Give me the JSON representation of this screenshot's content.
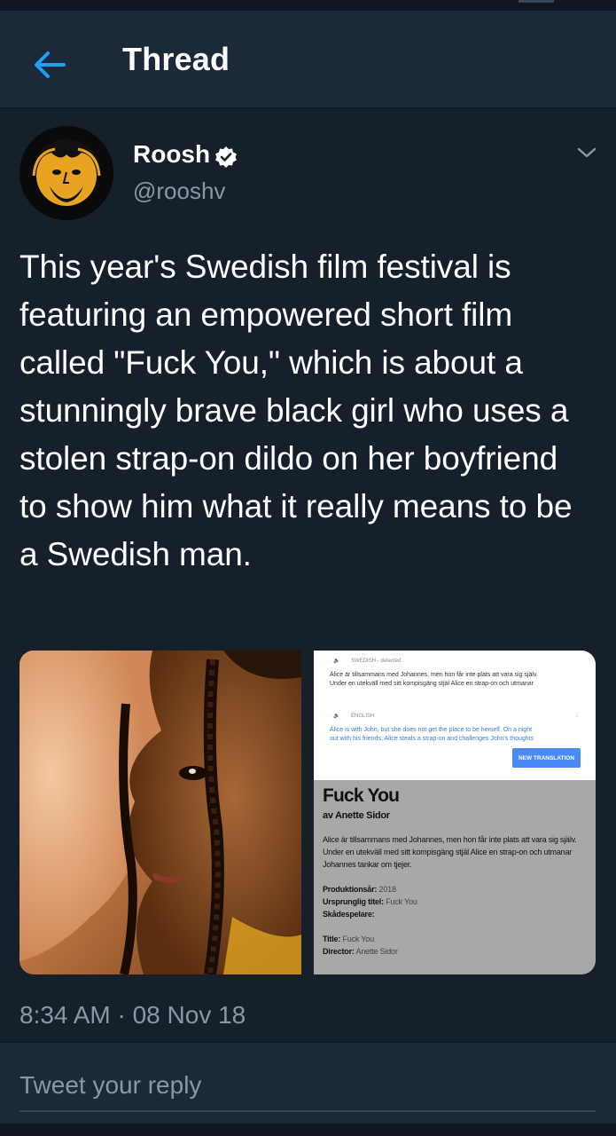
{
  "header": {
    "title": "Thread",
    "back_icon": "arrow-left-icon",
    "accent": "#1da1f2"
  },
  "tweet": {
    "author_name": "Roosh",
    "handle": "@rooshv",
    "verified": true,
    "text": "This year's Swedish film festival is featuring an empowered short film called \"Fuck You,\" which is about a stunningly brave black girl who uses a stolen strap-on dildo on her boyfriend to show him what it really means to be a Swedish man.",
    "timestamp": "8:34 AM · 08 Nov 18"
  },
  "media": {
    "translation": {
      "source_lang": "SWEDISH - detected",
      "source_line1": "Alice är tillsammans med Johannes, men hon får inte plats att vara sig själv.",
      "source_line2": "Under en utekväll med sitt kompisgäng stjäl Alice en strap-on och utmanar",
      "target_lang": "ENGLISH",
      "target_line1": "Alice is with John, but she does not get the place to be herself. On a night",
      "target_line2": "out with his friends, Alice steals a strap-on and challenges John's thoughts",
      "button": "NEW TRANSLATION"
    },
    "document": {
      "title": "Fuck You",
      "author": "av Anette Sidor",
      "description": "Alice är tillsammans med Johannes, men hon får inte plats att vara sig själv. Under en utekväll med sitt kompisgäng stjäl Alice en strap-on och utmanar Johannes tankar om tjejer.",
      "year_label": "Produktionsår:",
      "year_value": "2018",
      "orig_title_label": "Ursprunglig titel:",
      "orig_title_value": "Fuck You",
      "cast_label": "Skådespelare:",
      "title_label": "Title:",
      "title_value": "Fuck You",
      "director_label": "Director:",
      "director_value": "Anette Sidor"
    }
  },
  "reply": {
    "placeholder": "Tweet your reply"
  }
}
